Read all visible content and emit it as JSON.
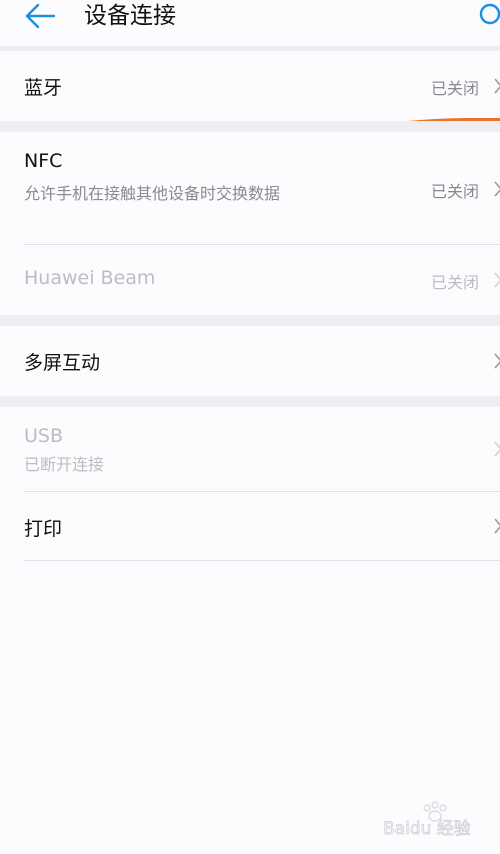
{
  "header": {
    "title": "设备连接",
    "back_icon": "arrow-left-icon",
    "search_icon": "search-icon"
  },
  "sections": [
    {
      "items": [
        {
          "title": "蓝牙",
          "status": "已关闭",
          "icon": "chevron-right-icon"
        }
      ]
    },
    {
      "items": [
        {
          "title": "NFC",
          "subtitle": "允许手机在接触其他设备时交换数据",
          "status": "已关闭",
          "icon": "chevron-right-icon"
        },
        {
          "title": "Huawei Beam",
          "status": "已关闭",
          "disabled": true,
          "icon": "chevron-right-icon"
        }
      ]
    },
    {
      "items": [
        {
          "title": "多屏互动",
          "icon": "chevron-right-icon"
        }
      ]
    },
    {
      "items": [
        {
          "title": "USB",
          "subtitle": "已断开连接",
          "disabled": true,
          "icon": "chevron-right-icon"
        },
        {
          "title": "打印",
          "icon": "chevron-right-icon"
        }
      ]
    }
  ],
  "watermark": {
    "text": "Baidu 经验",
    "icon": "baidu-paw-icon"
  },
  "colors": {
    "accent": "#1a8fe3",
    "highlight_bar": "#e8742a",
    "background": "#fcfbfd",
    "section_gap": "#eeedf1",
    "disabled_text": "#bdbdc1"
  }
}
